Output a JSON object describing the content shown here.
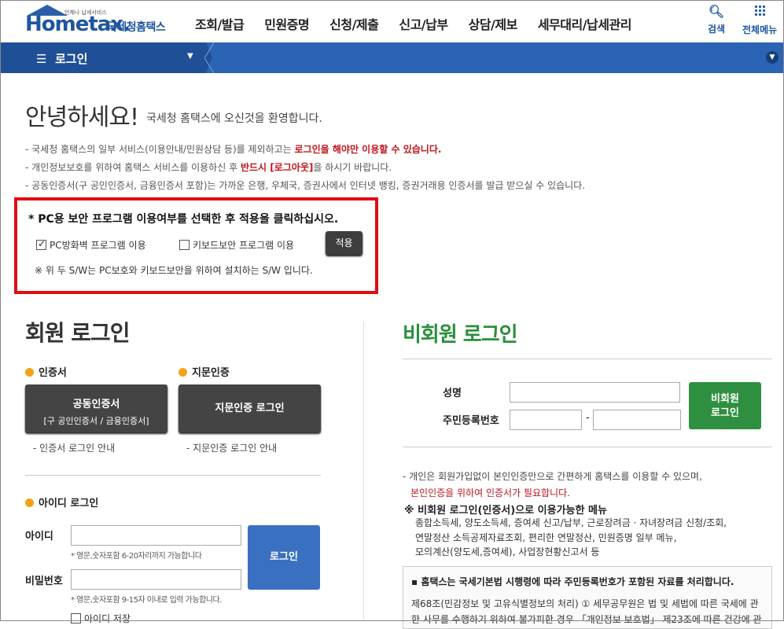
{
  "header": {
    "logo_text": "Hometax.",
    "logo_tagline": "언제나 납세서비스",
    "logo_subtitle": "국세청홈택스",
    "nav": [
      "조회/발급",
      "민원증명",
      "신청/제출",
      "신고/납부",
      "상담/제보",
      "세무대리/납세관리"
    ],
    "search_label": "검색",
    "all_menu_label": "전체메뉴"
  },
  "locbar": {
    "title": "로그인"
  },
  "welcome": {
    "title": "안녕하세요!",
    "subtitle": "국세청 홈택스에 오신것을 환영합니다.",
    "note1_pre": "국세청 홈택스의 일부 서비스(이용안내/민원상담 등)를 제외하고는 ",
    "note1_red": "로그인을 해야만 이용할 수 있습니다.",
    "note2_pre": "개인정보보호를 위하여 홈택스 서비스를 이용하신 후 ",
    "note2_red": "반드시 [로그아웃]",
    "note2_post": "을 하시기 바랍니다.",
    "note3": "공동인증서(구 공인인증서, 금융인증서 포함)는 가까운 은행, 우체국, 증권사에서 인터넷 뱅킹, 증권거래용 인증서를 발급 받으실 수 있습니다."
  },
  "security": {
    "title": "* PC용 보안 프로그램 이용여부를 선택한 후 적용을 클릭하십시오.",
    "firewall_label": "PC방화벽 프로그램 이용",
    "firewall_checked": true,
    "keyboard_label": "키보드보안 프로그램 이용",
    "keyboard_checked": false,
    "apply_label": "적용",
    "note": "※ 위 두 S/W는 PC보호와 키보드보안을 위하여 설치하는 S/W 입니다."
  },
  "member": {
    "title": "회원 로그인",
    "cert_heading": "인증서",
    "cert_button_line1": "공동인증서",
    "cert_button_line2": "[구 공인인증서 / 금융인증서]",
    "cert_guide": "인증서 로그인 안내",
    "finger_heading": "지문인증",
    "finger_button": "지문인증 로그인",
    "finger_guide": "지문인증 로그인 안내",
    "id_heading": "아이디 로그인",
    "id_label": "아이디",
    "id_hint": "* 영문,숫자포함 6-20자리까지 가능합니다",
    "pw_label": "비밀번호",
    "pw_hint": "* 영문,숫자포함 9-15자 이내로 입력 가능합니다.",
    "save_id_label": "아이디 저장",
    "login_button": "로그인"
  },
  "nonmember": {
    "title": "비회원 로그인",
    "name_label": "성명",
    "rrn_label": "주민등록번호",
    "rrn_sep": "-",
    "login_button_l1": "비회원",
    "login_button_l2": "로그인",
    "note1": "개인은 회원가입없이 본인인증만으로 간편하게 홈택스를 이용할 수 있으며,",
    "note2_red": "본인인증을 위하여 인증서가 필요합니다.",
    "menu_title": "※ 비회원 로그인(인증서)으로 이용가능한 메뉴",
    "menu_lines": [
      "종합소득세, 양도소득세, 증여세 신고/납부, 근로장려금 · 자녀장려금 신청/조회,",
      "연말정산 소득공제자료조회, 편리한 연말정산, 민원증명 일부 메뉴,",
      "모의계산(양도세,증여세), 사업장현황신고서 등"
    ],
    "info_title": "홈택스는 국세기본법 시행령에 따라 주민등록번호가 포함된 자료를 처리합니다.",
    "info_text": "제68조(민감정보 및 고유식별정보의 처리) ① 세무공무원은 법 및 세법에 따른 국세에 관한 사무를 수행하기 위하여 불가피한 경우 「개인정보 보호법」 제23조에 따른 건강에 관"
  }
}
